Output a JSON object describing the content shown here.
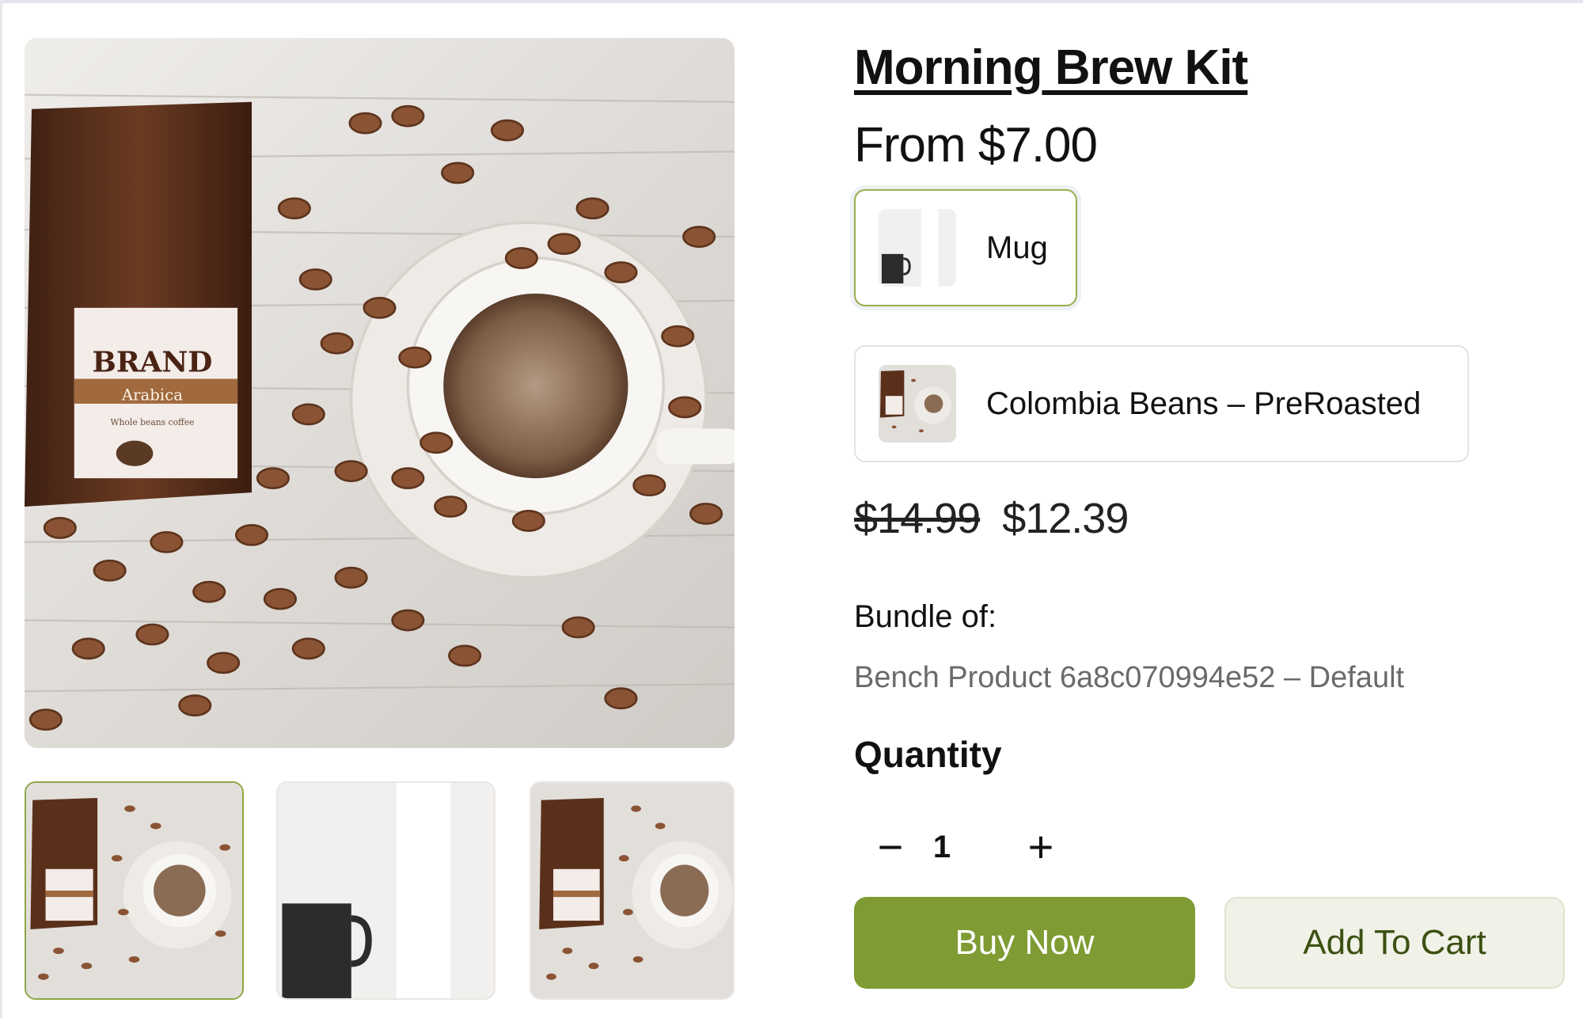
{
  "product": {
    "title": "Morning Brew Kit",
    "from_price": "From $7.00",
    "variants": [
      {
        "label": "Mug",
        "selected": true,
        "thumb_icon": "mug-thumbnail"
      },
      {
        "label": "Colombia Beans – PreRoasted",
        "selected": false,
        "thumb_icon": "coffee-beans-thumbnail"
      }
    ],
    "original_price": "$14.99",
    "sale_price": "$12.39",
    "bundle_label": "Bundle of:",
    "bundle_item": "Bench Product 6a8c070994e52 – Default",
    "quantity_label": "Quantity",
    "quantity_value": "1",
    "quantity_minus": "−",
    "quantity_plus": "+"
  },
  "gallery": {
    "main_image": "coffee-bag-and-cup",
    "package_text": {
      "brand": "BRAND",
      "variety": "Arabica",
      "note": "Whole beans coffee"
    },
    "thumbnails": [
      {
        "image": "coffee-bag-and-cup",
        "active": true
      },
      {
        "image": "black-mug",
        "active": false
      },
      {
        "image": "coffee-bag-and-cup",
        "active": false
      }
    ]
  },
  "actions": {
    "buy_now": "Buy Now",
    "add_to_cart": "Add To Cart"
  },
  "colors": {
    "accent": "#7f9b33",
    "selected_border": "#96ae4b",
    "cart_bg": "#f0f1e7",
    "cart_text": "#3b5012"
  }
}
